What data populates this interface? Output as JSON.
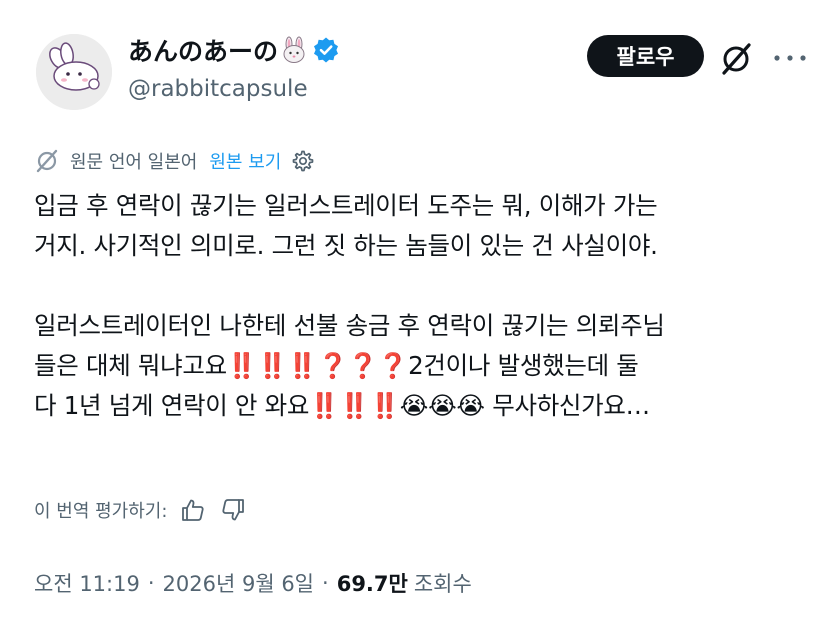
{
  "author": {
    "display_name": "あんのあーの",
    "name_emoji": "rabbit-face-icon",
    "verified_icon": "verified-badge-icon",
    "handle": "@rabbitcapsule",
    "avatar": "cartoon-rabbit-avatar"
  },
  "header": {
    "follow_label": "팔로우",
    "grok_icon": "slashed-circle-icon",
    "more_icon": "more-dots-icon"
  },
  "translation": {
    "source_label": "원문 언어 일본어",
    "show_original_label": "원본 보기",
    "settings_icon": "gear-icon"
  },
  "tweet": {
    "lines": [
      "입금 후 연락이 끊기는 일러스트레이터 도주는 뭐, 이해가 가는",
      "거지. 사기적인 의미로. 그런 짓 하는 놈들이 있는 건 사실이야.",
      "",
      "일러스트레이터인 나한테 선불 송금 후 연락이 끊기는 의뢰주님",
      "들은 대체 뭐냐고요‼️‼️‼️❓❓❓2건이나 발생했는데 둘",
      "다 1년 넘게 연락이 안 와요‼️‼️‼️😭😭😭 무사하신가요…"
    ]
  },
  "rating": {
    "label": "이 번역 평가하기:",
    "thumbs_up_icon": "thumbs-up-icon",
    "thumbs_down_icon": "thumbs-down-icon"
  },
  "meta": {
    "time": "오전 11:19",
    "separator": "·",
    "date": "2026년 9월 6일",
    "views_count": "69.7만",
    "views_label": "조회수"
  },
  "colors": {
    "text": "#0f1419",
    "secondary": "#536471",
    "link": "#1d9bf0",
    "verified": "#1d9bf0",
    "button_bg": "#0f1419"
  }
}
